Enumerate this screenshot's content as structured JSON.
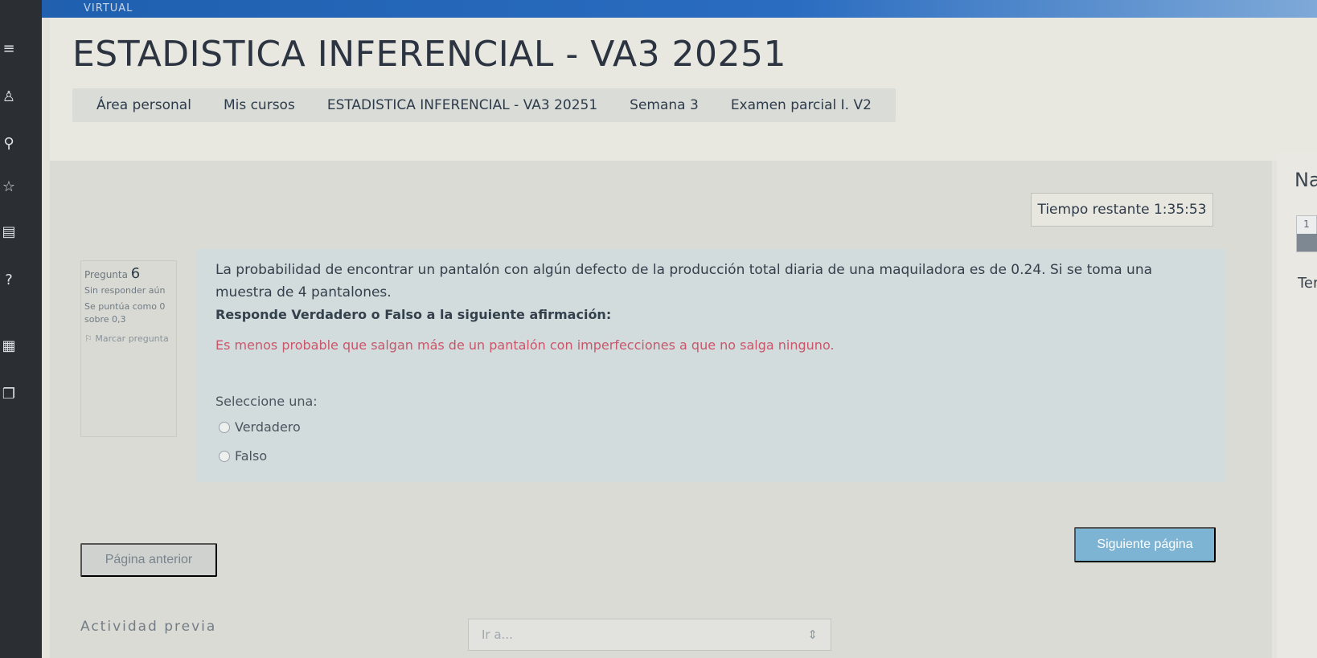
{
  "topbar": {
    "brand_text": "VIRTUAL"
  },
  "header": {
    "course_title": "ESTADISTICA INFERENCIAL - VA3 20251",
    "breadcrumb": [
      "Área personal",
      "Mis cursos",
      "ESTADISTICA INFERENCIAL - VA3 20251",
      "Semana 3",
      "Examen parcial I. V2"
    ]
  },
  "timer": {
    "label": "Tiempo restante 1:35:53"
  },
  "question_info": {
    "number_label": "Pregunta",
    "number": "6",
    "status": "Sin responder aún",
    "score": "Se puntúa como 0 sobre 0,3",
    "flag_label": "Marcar pregunta"
  },
  "question": {
    "statement": "La probabilidad de encontrar un pantalón con algún defecto de la producción total diaria de una maquiladora es de 0.24. Si se toma una muestra de 4 pantalones.",
    "instruction": "Responde Verdadero o Falso a la siguiente afirmación:",
    "claim": "Es menos probable que salgan más de un pantalón con imperfecciones a que no salga ninguno.",
    "prompt": "Seleccione una:",
    "options": [
      "Verdadero",
      "Falso"
    ]
  },
  "navigation": {
    "prev_label": "Página anterior",
    "next_label": "Siguiente página"
  },
  "footer": {
    "previous_activity": "Actividad previa",
    "goto_placeholder": "Ir a..."
  },
  "right_panel": {
    "title_partial": "Na",
    "box_number": "1",
    "text_partial": "Ter"
  },
  "colors": {
    "accent": "#7eb4d3",
    "claim": "#c9566b",
    "topbar": "#2a6cc0",
    "sidebar": "#2b2e33"
  }
}
